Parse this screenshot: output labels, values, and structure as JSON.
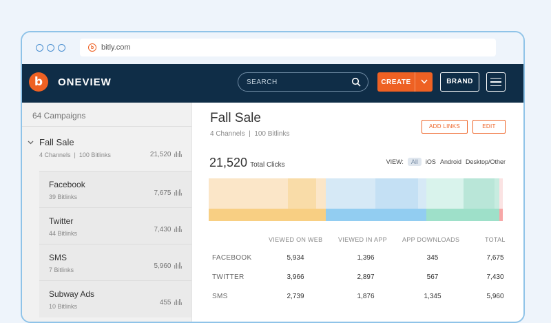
{
  "browser": {
    "url": "bitly.com"
  },
  "header": {
    "brand_initial": "b",
    "brand_name": "ONEVIEW",
    "search_placeholder": "SEARCH",
    "create_label": "CREATE",
    "brand_button_label": "BRAND"
  },
  "sidebar": {
    "campaign_count": "64 Campaigns",
    "active_campaign": {
      "name": "Fall Sale",
      "channels": "4 Channels",
      "bitlinks": "100 Bitlinks",
      "clicks": "21,520"
    },
    "channels": [
      {
        "name": "Facebook",
        "bitlinks": "39 Bitlinks",
        "clicks": "7,675"
      },
      {
        "name": "Twitter",
        "bitlinks": "44 Bitlinks",
        "clicks": "7,430"
      },
      {
        "name": "SMS",
        "bitlinks": "7 Bitlinks",
        "clicks": "5,960"
      },
      {
        "name": "Subway Ads",
        "bitlinks": "10 Bitlinks",
        "clicks": "455"
      }
    ]
  },
  "main": {
    "title": "Fall Sale",
    "channels": "4 Channels",
    "bitlinks": "100 Bitlinks",
    "add_links_label": "ADD LINKS",
    "edit_label": "EDIT",
    "total_clicks": "21,520",
    "total_clicks_label": "Total Clicks",
    "view_label": "VIEW:",
    "view_options": [
      "All",
      "iOS",
      "Android",
      "Desktop/Other"
    ],
    "table": {
      "headers": [
        "VIEWED ON WEB",
        "VIEWED IN APP",
        "APP DOWNLOADS",
        "TOTAL"
      ],
      "rows": [
        {
          "label": "FACEBOOK",
          "values": [
            "5,934",
            "1,396",
            "345",
            "7,675"
          ]
        },
        {
          "label": "TWITTER",
          "values": [
            "3,966",
            "2,897",
            "567",
            "7,430"
          ]
        },
        {
          "label": "SMS",
          "values": [
            "2,739",
            "1,876",
            "1,345",
            "5,960"
          ]
        }
      ]
    }
  },
  "colors": {
    "navy": "#0f2d47",
    "orange": "#ee6123",
    "web_light": "#fbe6c8",
    "web_mid": "#f9dca8",
    "web_strong": "#f8cf83",
    "app_light": "#d6e9f6",
    "app_mid": "#c4e0f4",
    "app_strong": "#92cdf1",
    "download_light": "#d9f3ec",
    "download_mid": "#b9e6d8",
    "download_strong": "#9ee0c9",
    "other_light": "#fbe3e3",
    "other_strong": "#f7a7a7"
  }
}
